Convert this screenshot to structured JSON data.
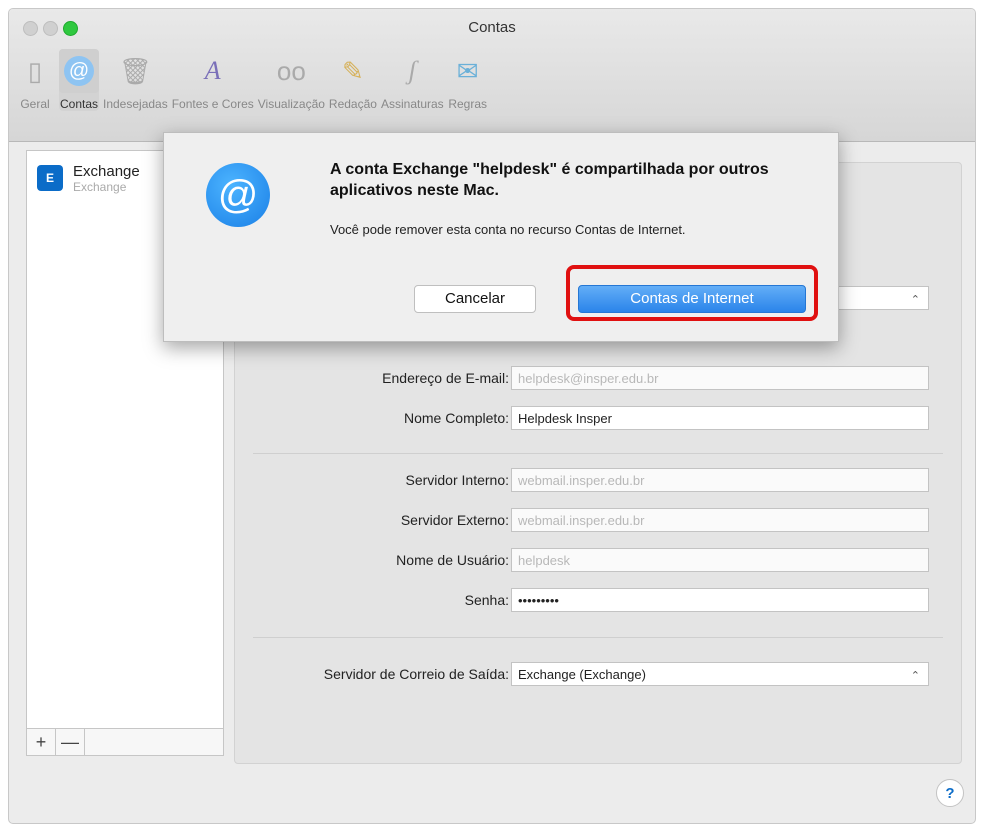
{
  "window": {
    "title": "Contas"
  },
  "toolbar": {
    "items": [
      {
        "label": "Geral",
        "icon": "switch-icon"
      },
      {
        "label": "Contas",
        "icon": "at-sign-icon"
      },
      {
        "label": "Indesejadas",
        "icon": "trash-icon"
      },
      {
        "label": "Fontes e Cores",
        "icon": "fonts-icon"
      },
      {
        "label": "Visualização",
        "icon": "glasses-icon"
      },
      {
        "label": "Redação",
        "icon": "pencil-icon"
      },
      {
        "label": "Assinaturas",
        "icon": "signature-icon"
      },
      {
        "label": "Regras",
        "icon": "rules-icon"
      }
    ]
  },
  "account": {
    "name": "Exchange",
    "type": "Exchange"
  },
  "fields": {
    "alias_value": "helpdesk@insper.edu.br>",
    "email_label": "Endereço de E-mail:",
    "email_value": "helpdesk@insper.edu.br",
    "fullname_label": "Nome Completo:",
    "fullname_value": "Helpdesk Insper",
    "internal_label": "Servidor Interno:",
    "internal_value": "webmail.insper.edu.br",
    "external_label": "Servidor Externo:",
    "external_value": "webmail.insper.edu.br",
    "username_label": "Nome de Usuário:",
    "username_value": "helpdesk",
    "password_label": "Senha:",
    "password_value": "•••••••••",
    "smtp_label": "Servidor de Correio de Saída:",
    "smtp_value": "Exchange (Exchange)"
  },
  "list_footer": {
    "add": "+",
    "remove": "—"
  },
  "help": "?",
  "dialog": {
    "title": "A conta Exchange \"helpdesk\" é compartilhada por outros aplicativos neste Mac.",
    "message": "Você pode remover esta conta no recurso Contas de Internet.",
    "cancel": "Cancelar",
    "primary": "Contas de Internet"
  },
  "colors": {
    "accent": "#2a84ea",
    "highlight": "#e01010"
  }
}
